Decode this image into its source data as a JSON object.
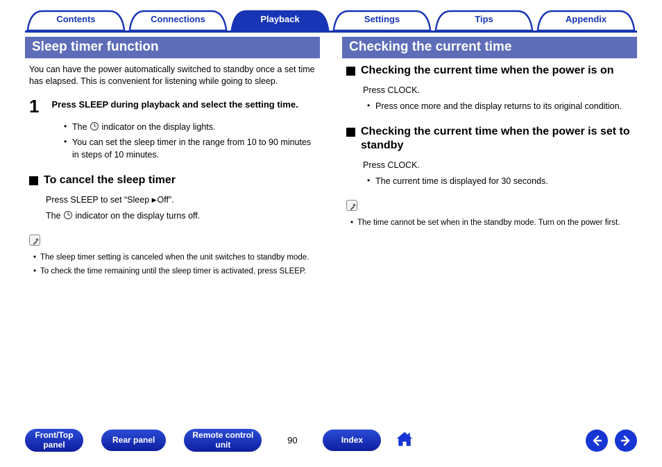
{
  "tabs": {
    "contents": "Contents",
    "connections": "Connections",
    "playback": "Playback",
    "settings": "Settings",
    "tips": "Tips",
    "appendix": "Appendix",
    "active": "playback"
  },
  "left": {
    "header": "Sleep timer function",
    "intro": "You can have the power automatically switched to standby once a set time has elapsed. This is convenient for listening while going to sleep.",
    "step1_num": "1",
    "step1_text": "Press SLEEP during playback and select the setting time.",
    "step1_b1_pre": "The ",
    "step1_b1_post": " indicator on the display lights.",
    "step1_b2": "You can set the sleep timer in the range from 10 to 90 minutes in steps of 10 minutes.",
    "cancel_title": "To cancel the sleep timer",
    "cancel_p1_pre": "Press SLEEP to set “Sleep ",
    "cancel_p1_post": "Off”.",
    "cancel_p2_pre": "The ",
    "cancel_p2_post": " indicator on the display turns off.",
    "note1": "The sleep timer setting is canceled when the unit switches to standby mode.",
    "note2": "To check the time remaining until the sleep timer is activated, press SLEEP."
  },
  "right": {
    "header": "Checking the current time",
    "s1_title": "Checking the current time when the power is on",
    "s1_p": "Press CLOCK.",
    "s1_b": "Press once more and the display returns to its original condition.",
    "s2_title": "Checking the current time when the power is set to standby",
    "s2_p": "Press CLOCK.",
    "s2_b": "The current time is displayed for 30 seconds.",
    "note": "The time cannot be set when in the standby mode. Turn on the power first."
  },
  "footer": {
    "fronttop_l1": "Front/Top",
    "fronttop_l2": "panel",
    "rear": "Rear panel",
    "remote_l1": "Remote control",
    "remote_l2": "unit",
    "page": "90",
    "index": "Index"
  }
}
